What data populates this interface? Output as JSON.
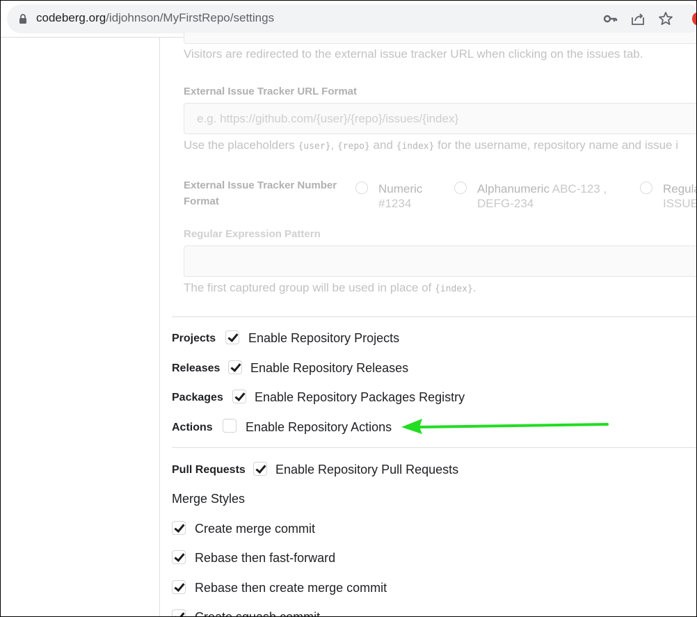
{
  "browser": {
    "url_host": "codeberg.org",
    "url_path": "/idjohnson/MyFirstRepo/settings",
    "icons": [
      "lock-icon",
      "key-icon",
      "share-icon",
      "star-icon"
    ]
  },
  "tracker": {
    "redirect_help": "Visitors are redirected to the external issue tracker URL when clicking on the issues tab.",
    "url_format_label": "External Issue Tracker URL Format",
    "url_format_placeholder": "e.g. https://github.com/{user}/{repo}/issues/{index}",
    "placeholders_help_start": "Use the placeholders ",
    "code_user": "{user}",
    "comma": ", ",
    "code_repo": "{repo}",
    "and": " and ",
    "code_index": "{index}",
    "placeholders_help_end": " for the username, repository name and issue i",
    "number_format_label_1": "External Issue Tracker Number",
    "number_format_label_2": "Format",
    "numeric_label": "Numeric",
    "numeric_example": "#1234",
    "alnum_label": "Alphanumeric",
    "alnum_example_1": "ABC-123 ,",
    "alnum_example_2": "DEFG-234",
    "regexp_label": "Regula",
    "regexp_example": "ISSUE-",
    "regex_pattern_label": "Regular Expression Pattern",
    "regex_help_start": "The first captured group will be used in place of ",
    "regex_help_code": "{index}",
    "regex_help_end": "."
  },
  "units": {
    "projects": {
      "label": "Projects",
      "checkbox": "Enable Repository Projects",
      "checked": true
    },
    "releases": {
      "label": "Releases",
      "checkbox": "Enable Repository Releases",
      "checked": true
    },
    "packages": {
      "label": "Packages",
      "checkbox": "Enable Repository Packages Registry",
      "checked": true
    },
    "actions": {
      "label": "Actions",
      "checkbox": "Enable Repository Actions",
      "checked": false
    },
    "pulls": {
      "label": "Pull Requests",
      "checkbox": "Enable Repository Pull Requests",
      "checked": true
    }
  },
  "merge_styles": {
    "title": "Merge Styles",
    "items": [
      {
        "label": "Create merge commit",
        "checked": true
      },
      {
        "label": "Rebase then fast-forward",
        "checked": true
      },
      {
        "label": "Rebase then create merge commit",
        "checked": true
      },
      {
        "label": "Create squash commit",
        "checked": true
      }
    ]
  },
  "annotation": {
    "arrow_color": "#22dd22"
  }
}
